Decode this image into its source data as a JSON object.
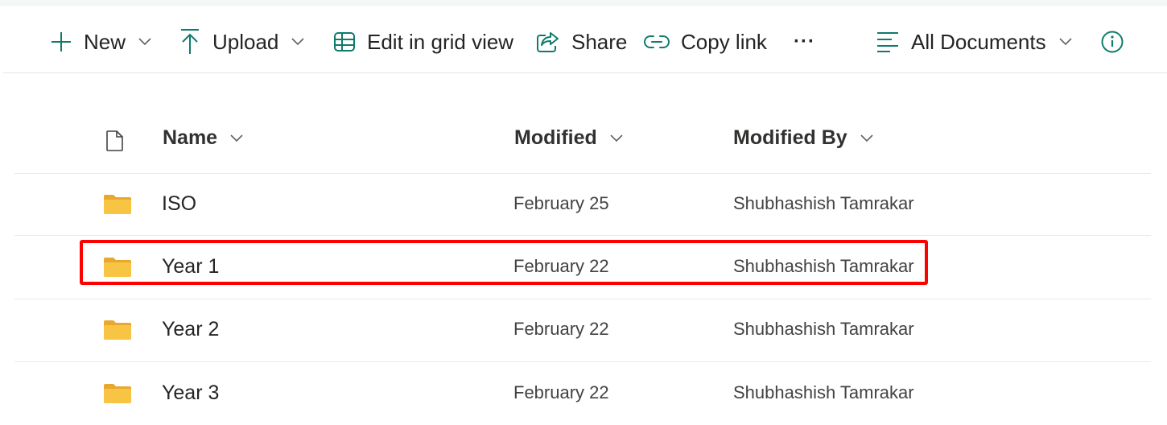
{
  "commandbar": {
    "new_label": "New",
    "upload_label": "Upload",
    "edit_grid_label": "Edit in grid view",
    "share_label": "Share",
    "copy_link_label": "Copy link",
    "more_label": "···",
    "view_label": "All Documents"
  },
  "list": {
    "columns": {
      "name": "Name",
      "modified": "Modified",
      "modified_by": "Modified By"
    },
    "rows": [
      {
        "name": "ISO",
        "modified": "February 25",
        "modified_by": "Shubhashish Tamrakar"
      },
      {
        "name": "Year 1",
        "modified": "February 22",
        "modified_by": "Shubhashish Tamrakar"
      },
      {
        "name": "Year 2",
        "modified": "February 22",
        "modified_by": "Shubhashish Tamrakar"
      },
      {
        "name": "Year 3",
        "modified": "February 22",
        "modified_by": "Shubhashish Tamrakar"
      }
    ]
  },
  "icons": {
    "accent": "#0f7b6c",
    "folder": "#f7c543",
    "highlight": "#ff0000"
  }
}
